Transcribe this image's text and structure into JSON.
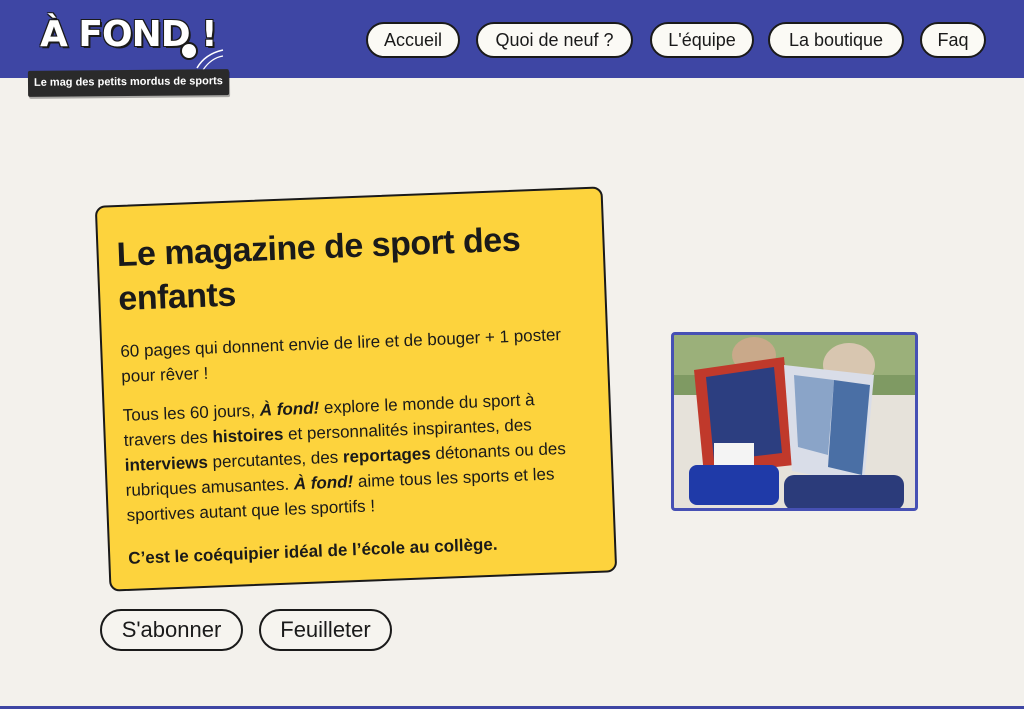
{
  "header": {
    "logo_text": "À FOND !",
    "tagline": "Le mag des petits mordus de sports",
    "brand_color": "#3e46a4"
  },
  "nav": {
    "items": [
      {
        "label": "Accueil"
      },
      {
        "label": "Quoi de neuf ?"
      },
      {
        "label": "L'équipe"
      },
      {
        "label": "La boutique"
      },
      {
        "label": "Faq"
      }
    ]
  },
  "hero": {
    "title": "Le magazine de sport des enfants",
    "intro": "60 pages qui donnent envie de lire et de bouger + 1 poster pour rêver !",
    "body_parts": {
      "p1": "Tous les 60 jours, ",
      "brand1": "À fond!",
      "p2": " explore le monde du sport à travers des ",
      "b1": "histoires",
      "p3": " et personnalités inspirantes, des ",
      "b2": "interviews",
      "p4": " percutantes, des ",
      "b3": "reportages",
      "p5": " détonants ou des rubriques amusantes. ",
      "brand2": "À fond!",
      "p6": " aime tous les sports et les sportives autant que les sportifs !"
    },
    "closing": "C’est le coéquipier idéal de l’école au collège.",
    "card_color": "#fdd33d"
  },
  "actions": {
    "subscribe_label": "S'abonner",
    "browse_label": "Feuilleter"
  }
}
